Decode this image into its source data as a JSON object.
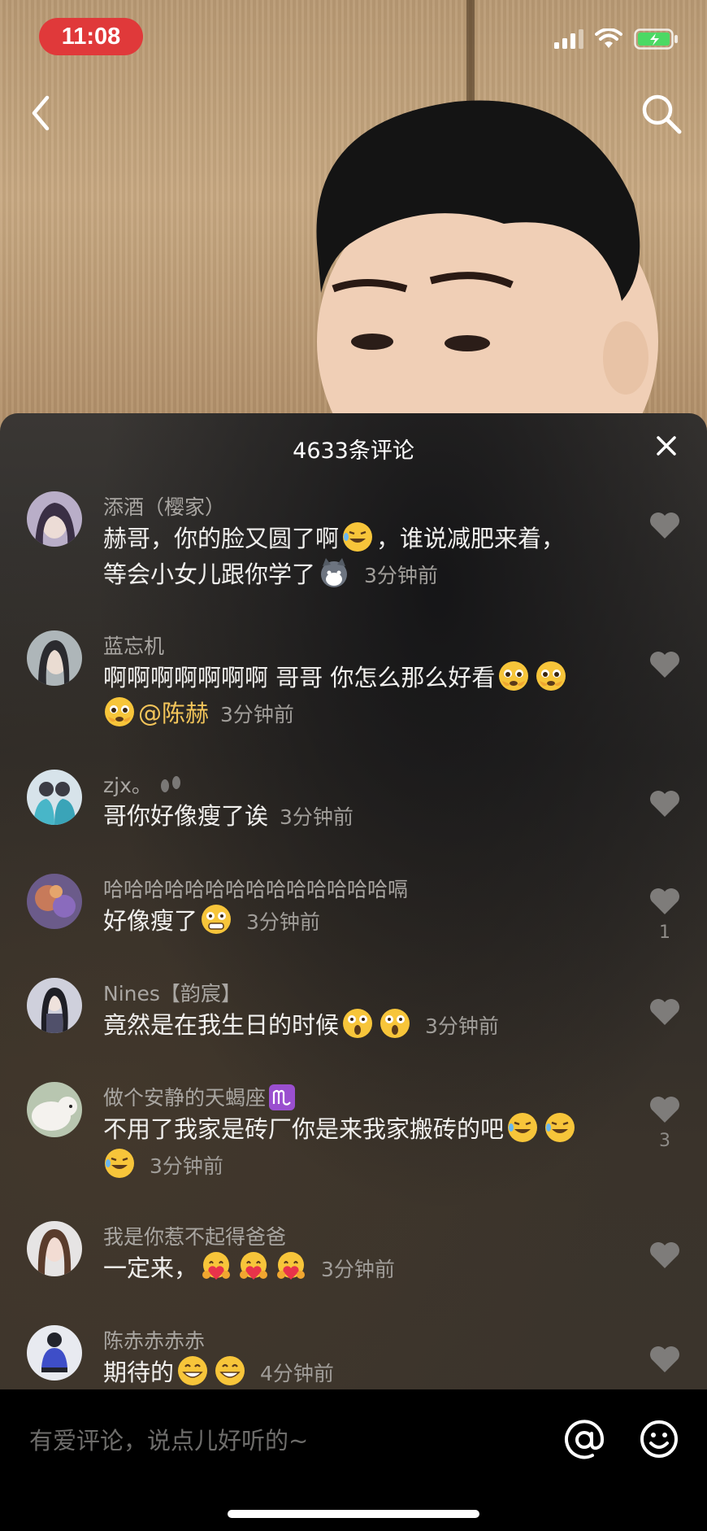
{
  "status_bar": {
    "time": "11:08"
  },
  "panel": {
    "title": "4633条评论"
  },
  "comments": [
    {
      "name": "添酒（樱家）",
      "line1": "赫哥，你的脸又圆了啊",
      "line1b": "，谁说减肥来着，",
      "line2": "等会小女儿跟你学了",
      "time": "3分钟前",
      "likes": ""
    },
    {
      "name": "蓝忘机",
      "line1": "啊啊啊啊啊啊啊 哥哥 你怎么那么好看",
      "mention": "@陈赫",
      "time": "3分钟前",
      "likes": ""
    },
    {
      "name": "zjx。",
      "line1": "哥你好像瘦了诶",
      "time": "3分钟前",
      "likes": ""
    },
    {
      "name": "哈哈哈哈哈哈哈哈哈哈哈哈哈哈嗝",
      "line1": "好像瘦了",
      "time": "3分钟前",
      "likes": "1"
    },
    {
      "name": "Nines【韵宸】",
      "line1": "竟然是在我生日的时候",
      "time": "3分钟前",
      "likes": ""
    },
    {
      "name": "做个安静的天蝎座",
      "line1": "不用了我家是砖厂你是来我家搬砖的吧",
      "time": "3分钟前",
      "likes": "3"
    },
    {
      "name": "我是你惹不起得爸爸",
      "line1": "一定来，",
      "time": "3分钟前",
      "likes": ""
    },
    {
      "name": "陈赤赤赤赤",
      "line1": "期待的",
      "time": "4分钟前",
      "likes": ""
    }
  ],
  "input": {
    "placeholder": "有爱评论，说点儿好听的~"
  },
  "colors": {
    "time_pill": "#e0393a",
    "mention": "#f3c55a",
    "battery": "#4cd964"
  },
  "icons": [
    "back-icon",
    "search-icon",
    "close-icon",
    "heart-icon",
    "at-icon",
    "emoji-icon"
  ]
}
